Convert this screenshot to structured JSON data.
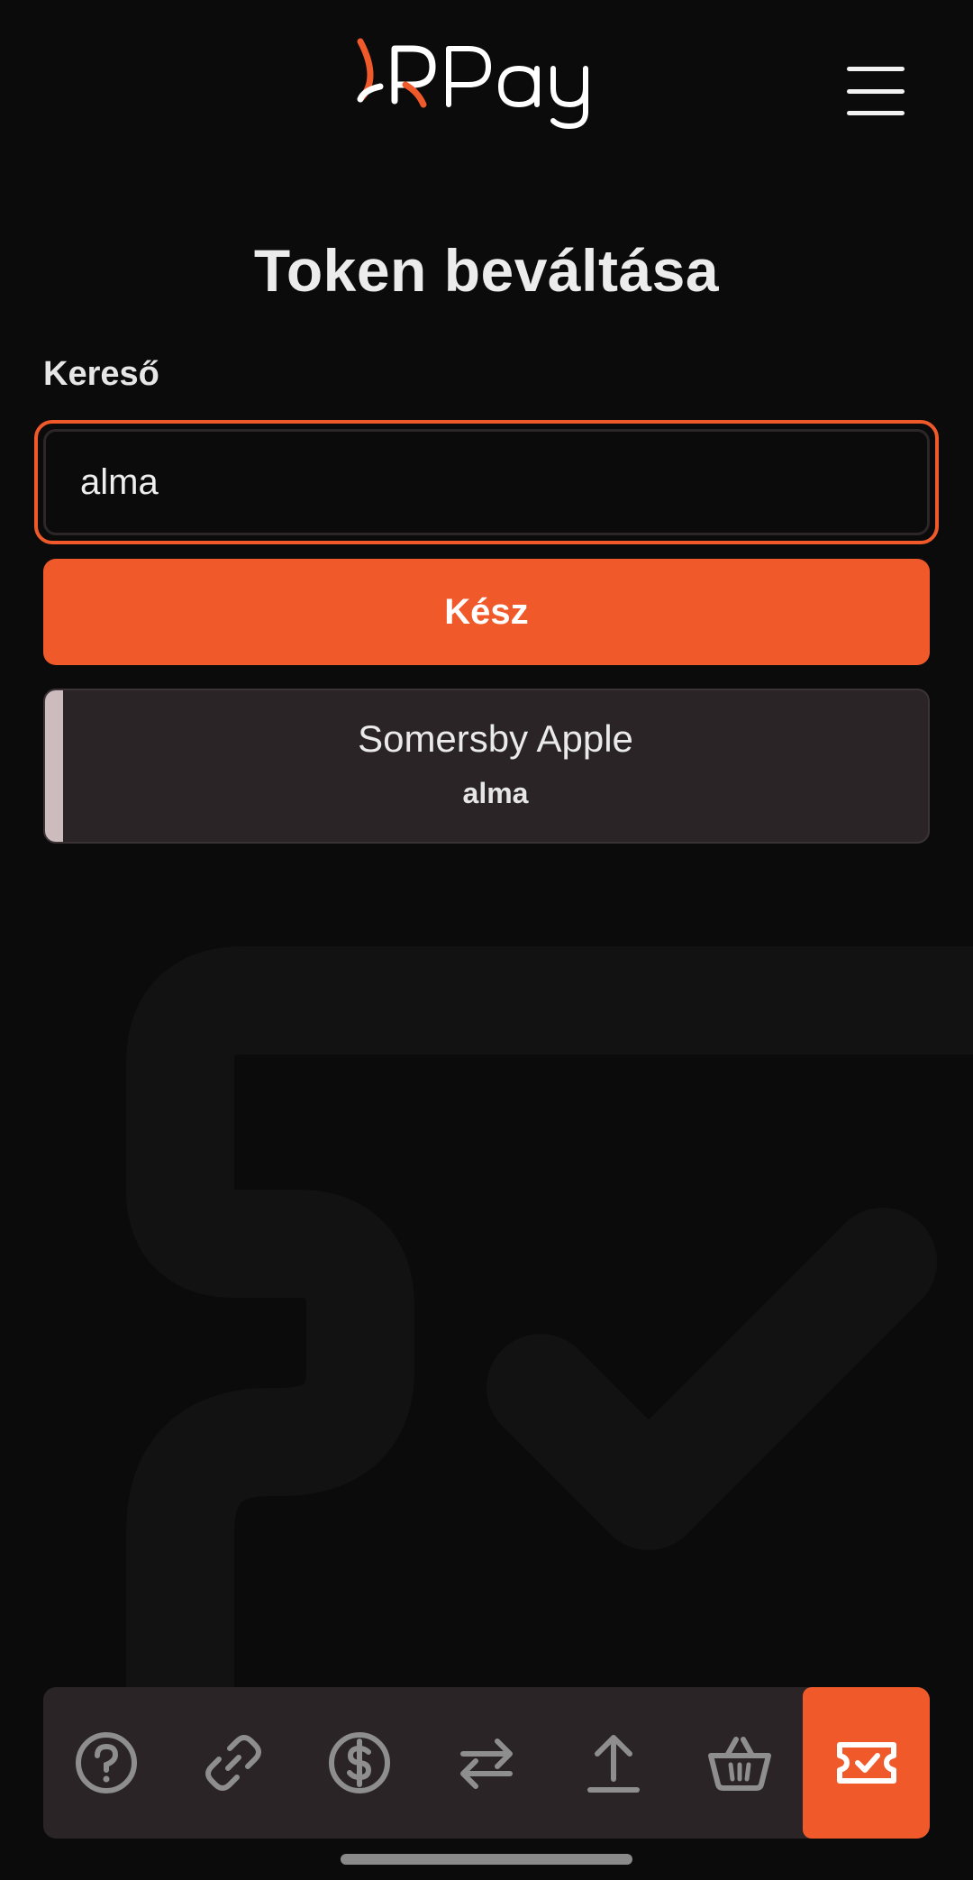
{
  "header": {
    "logo_text": "XRPay",
    "menu_icon": "hamburger-menu-icon"
  },
  "page": {
    "title": "Token beváltása"
  },
  "search": {
    "label": "Kereső",
    "value": "alma"
  },
  "actions": {
    "done_label": "Kész"
  },
  "results": [
    {
      "name": "Somersby Apple",
      "keyword": "alma"
    }
  ],
  "bottom_nav": {
    "items": [
      {
        "icon": "help-circle-icon",
        "active": false
      },
      {
        "icon": "link-icon",
        "active": false
      },
      {
        "icon": "dollar-circle-icon",
        "active": false
      },
      {
        "icon": "transfer-arrows-icon",
        "active": false
      },
      {
        "icon": "upload-icon",
        "active": false
      },
      {
        "icon": "basket-icon",
        "active": false
      },
      {
        "icon": "ticket-check-icon",
        "active": true
      }
    ]
  },
  "colors": {
    "accent": "#f05a2b",
    "background": "#0b0b0b",
    "card": "#2a2426",
    "card_accent": "#cdbcbd",
    "text": "#ececec"
  }
}
